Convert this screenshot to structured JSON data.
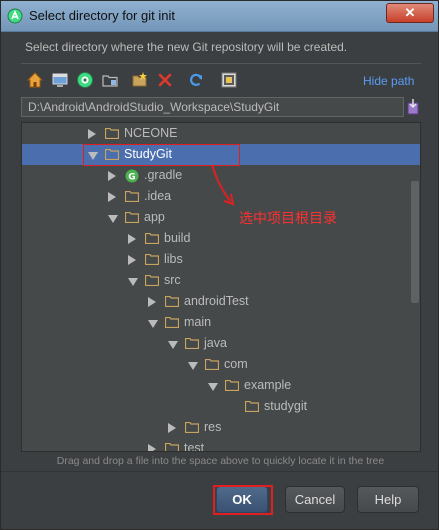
{
  "window": {
    "title": "Select directory for git init",
    "close_label": "✕"
  },
  "description": "Select directory where the new Git repository will be created.",
  "toolbar": {
    "icons": [
      "home-icon",
      "desktop-icon",
      "android-project-icon",
      "module-folder-icon",
      "new-folder-icon",
      "delete-icon",
      "refresh-icon",
      "show-hidden-icon"
    ],
    "hide_path_label": "Hide path"
  },
  "path": {
    "value": "D:\\Android\\AndroidStudio_Workspace\\StudyGit"
  },
  "tree": {
    "rows": [
      {
        "label": "NCEONE",
        "depth": 0,
        "expanded": false,
        "has_arrow": true,
        "icon": "folder",
        "selected": false
      },
      {
        "label": "StudyGit",
        "depth": 0,
        "expanded": true,
        "has_arrow": true,
        "icon": "folder",
        "selected": true
      },
      {
        "label": ".gradle",
        "depth": 1,
        "expanded": false,
        "has_arrow": true,
        "icon": "gradle",
        "selected": false
      },
      {
        "label": ".idea",
        "depth": 1,
        "expanded": false,
        "has_arrow": true,
        "icon": "folder",
        "selected": false
      },
      {
        "label": "app",
        "depth": 1,
        "expanded": true,
        "has_arrow": true,
        "icon": "folder",
        "selected": false
      },
      {
        "label": "build",
        "depth": 2,
        "expanded": false,
        "has_arrow": true,
        "icon": "folder",
        "selected": false
      },
      {
        "label": "libs",
        "depth": 2,
        "expanded": false,
        "has_arrow": true,
        "icon": "folder",
        "selected": false
      },
      {
        "label": "src",
        "depth": 2,
        "expanded": true,
        "has_arrow": true,
        "icon": "folder",
        "selected": false
      },
      {
        "label": "androidTest",
        "depth": 3,
        "expanded": false,
        "has_arrow": true,
        "icon": "folder",
        "selected": false
      },
      {
        "label": "main",
        "depth": 3,
        "expanded": true,
        "has_arrow": true,
        "icon": "folder",
        "selected": false
      },
      {
        "label": "java",
        "depth": 4,
        "expanded": true,
        "has_arrow": true,
        "icon": "folder",
        "selected": false
      },
      {
        "label": "com",
        "depth": 5,
        "expanded": true,
        "has_arrow": true,
        "icon": "folder",
        "selected": false
      },
      {
        "label": "example",
        "depth": 6,
        "expanded": true,
        "has_arrow": true,
        "icon": "folder",
        "selected": false
      },
      {
        "label": "studygit",
        "depth": 7,
        "expanded": false,
        "has_arrow": false,
        "icon": "folder",
        "selected": false
      },
      {
        "label": "res",
        "depth": 4,
        "expanded": false,
        "has_arrow": true,
        "icon": "folder",
        "selected": false
      },
      {
        "label": "test",
        "depth": 3,
        "expanded": false,
        "has_arrow": true,
        "icon": "folder",
        "selected": false
      }
    ]
  },
  "hint": "Drag and drop a file into the space above to quickly locate it in the tree",
  "buttons": {
    "ok": "OK",
    "cancel": "Cancel",
    "help": "Help"
  },
  "annotation": {
    "text": "选中项目根目录",
    "color": "#e02020"
  },
  "colors": {
    "selection": "#4b6eaf",
    "folder": "#c9a45c",
    "link": "#589df6",
    "gradle": "#4caf50"
  }
}
